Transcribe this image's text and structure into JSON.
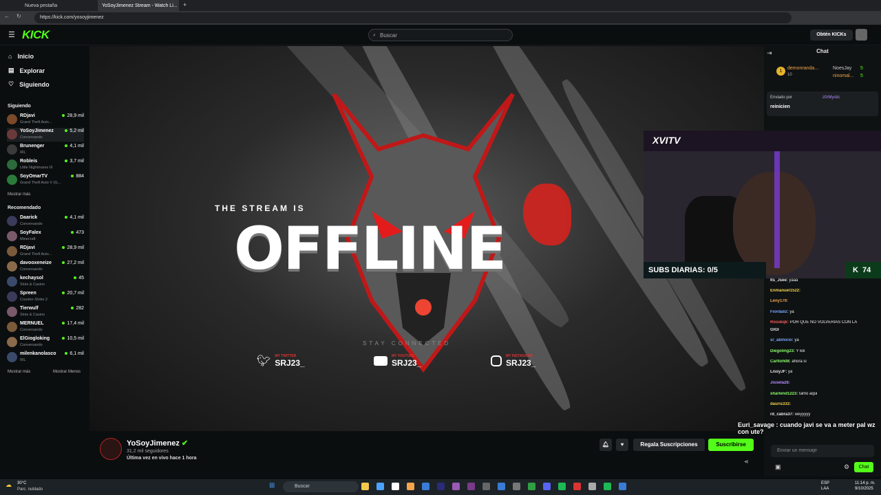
{
  "browser": {
    "tabs": [
      "Nueva pestaña",
      "YoSoyJimenez Stream - Watch Li..."
    ],
    "url": "https://kick.com/yosoyjimenez"
  },
  "header": {
    "logo": "KICK",
    "search_placeholder": "Buscar",
    "get_kicks": "Obtén KICKs"
  },
  "nav": {
    "home": "Inicio",
    "explore": "Explorar",
    "following": "Siguiendo"
  },
  "following_title": "Siguiendo",
  "following": [
    {
      "name": "RDjavi",
      "game": "Grand Theft Auto...",
      "viewers": "28,9 mil"
    },
    {
      "name": "YoSoyJimenez",
      "game": "Conversando",
      "viewers": "5,2 mil"
    },
    {
      "name": "Brunenger",
      "game": "IRL",
      "viewers": "4,1 mil"
    },
    {
      "name": "Robleis",
      "game": "Little Nightmares III",
      "viewers": "3,7 mil"
    },
    {
      "name": "SoyOmarTV",
      "game": "Grand Theft Auto V (G...",
      "viewers": "884"
    }
  ],
  "show_more": "Mostrar más",
  "recommended_title": "Recomendado",
  "recommended": [
    {
      "name": "Daarick",
      "game": "Conversando",
      "viewers": "4,1 mil"
    },
    {
      "name": "SoyFalex",
      "game": "Minecraft",
      "viewers": "473"
    },
    {
      "name": "RDjavi",
      "game": "Grand Theft Auto...",
      "viewers": "28,9 mil"
    },
    {
      "name": "davooxeneize",
      "game": "Conversando",
      "viewers": "27,2 mil"
    },
    {
      "name": "kechaysol",
      "game": "Slots & Casino",
      "viewers": "45"
    },
    {
      "name": "Spreen",
      "game": "Counter-Strike 2",
      "viewers": "20,7 mil"
    },
    {
      "name": "Tierwulf",
      "game": "Slots & Casino",
      "viewers": "282"
    },
    {
      "name": "MERNUEL",
      "game": "Conversando",
      "viewers": "17,4 mil"
    },
    {
      "name": "ElGiogloking",
      "game": "Conversando",
      "viewers": "10,5 mil"
    },
    {
      "name": "milenkanolasco",
      "game": "IRL",
      "viewers": "6,1 mil"
    }
  ],
  "show_more2": "Mostrar más",
  "show_less": "Mostrar Menos",
  "offline": {
    "line1": "THE STREAM IS",
    "line2": "OFFLINE",
    "stay": "STAY CONNECTED",
    "socials": [
      {
        "label": "MY TWITTER",
        "handle": "SRJ23_"
      },
      {
        "label": "MY YOUTUBE",
        "handle": "SRJ23_"
      },
      {
        "label": "MY INSTAGRAM",
        "handle": "SRJ23_"
      }
    ]
  },
  "overlay": {
    "brand": "XVITV",
    "subs": "SUBS DIARIAS: 0/5",
    "count": "74"
  },
  "chat": {
    "title": "Chat",
    "top": [
      {
        "name": "demonranda...",
        "n": "10"
      },
      {
        "name": "NoesJay",
        "n": "5"
      },
      {
        "name": "ninomal...",
        "n": "5"
      }
    ],
    "pinned_by": "Enviado por",
    "pinned_user": "z0rMystic",
    "pinned_text": "reinicien",
    "messages": [
      {
        "user": "Its_Jsee:",
        "text": "yaaa",
        "color": "#e6e6e6"
      },
      {
        "user": "Enmanuel1522:",
        "text": "",
        "color": "#f2d14b"
      },
      {
        "user": "Leny179:",
        "text": "",
        "color": "#f2a54b"
      },
      {
        "user": "Fiordaliz:",
        "text": "ya",
        "color": "#7aa7ff"
      },
      {
        "user": "Rosskqk:",
        "text": "POR QUÉ NO VOLVERIAS CON LA",
        "color": "#ff5a5a"
      },
      {
        "user": "GIGI",
        "text": "",
        "color": "#e6e6e6"
      },
      {
        "user": "sr_abinicio:",
        "text": "ya",
        "color": "#7aa7ff"
      },
      {
        "user": "Diegoling23:",
        "text": "Y kik",
        "color": "#8bff6b"
      },
      {
        "user": "Carltoh08:",
        "text": "ahora si",
        "color": "#8bff6b"
      },
      {
        "user": "LissyJF:",
        "text": "ya",
        "color": "#e6e6e6"
      },
      {
        "user": "Jissela28:",
        "text": "",
        "color": "#b48bff"
      },
      {
        "user": "sharlend1223:",
        "text": "tamo aqui",
        "color": "#8bff6b"
      },
      {
        "user": "dauris333:",
        "text": "",
        "color": "#f2d14b"
      },
      {
        "user": "rd_cabra37:",
        "text": "weyyyyy",
        "color": "#e6e6e6"
      }
    ],
    "big": "Euri_savage : cuando javi se va a meter pal wz con ute?",
    "input_placeholder": "Enviar un mensaje",
    "send": "Chat"
  },
  "channel": {
    "name": "YoSoyJimenez",
    "followers": "31,2 mil seguidores",
    "last_live": "Última vez en vivo hace 1 hora",
    "gift": "Regala Suscripciones",
    "subscribe": "Suscribirse"
  },
  "taskbar": {
    "weather_temp": "30°C",
    "weather_desc": "Parc. nublado",
    "search": "Buscar",
    "lang1": "ESP",
    "lang2": "LAA",
    "time": "11:14 p. m.",
    "date": "9/10/2025"
  }
}
